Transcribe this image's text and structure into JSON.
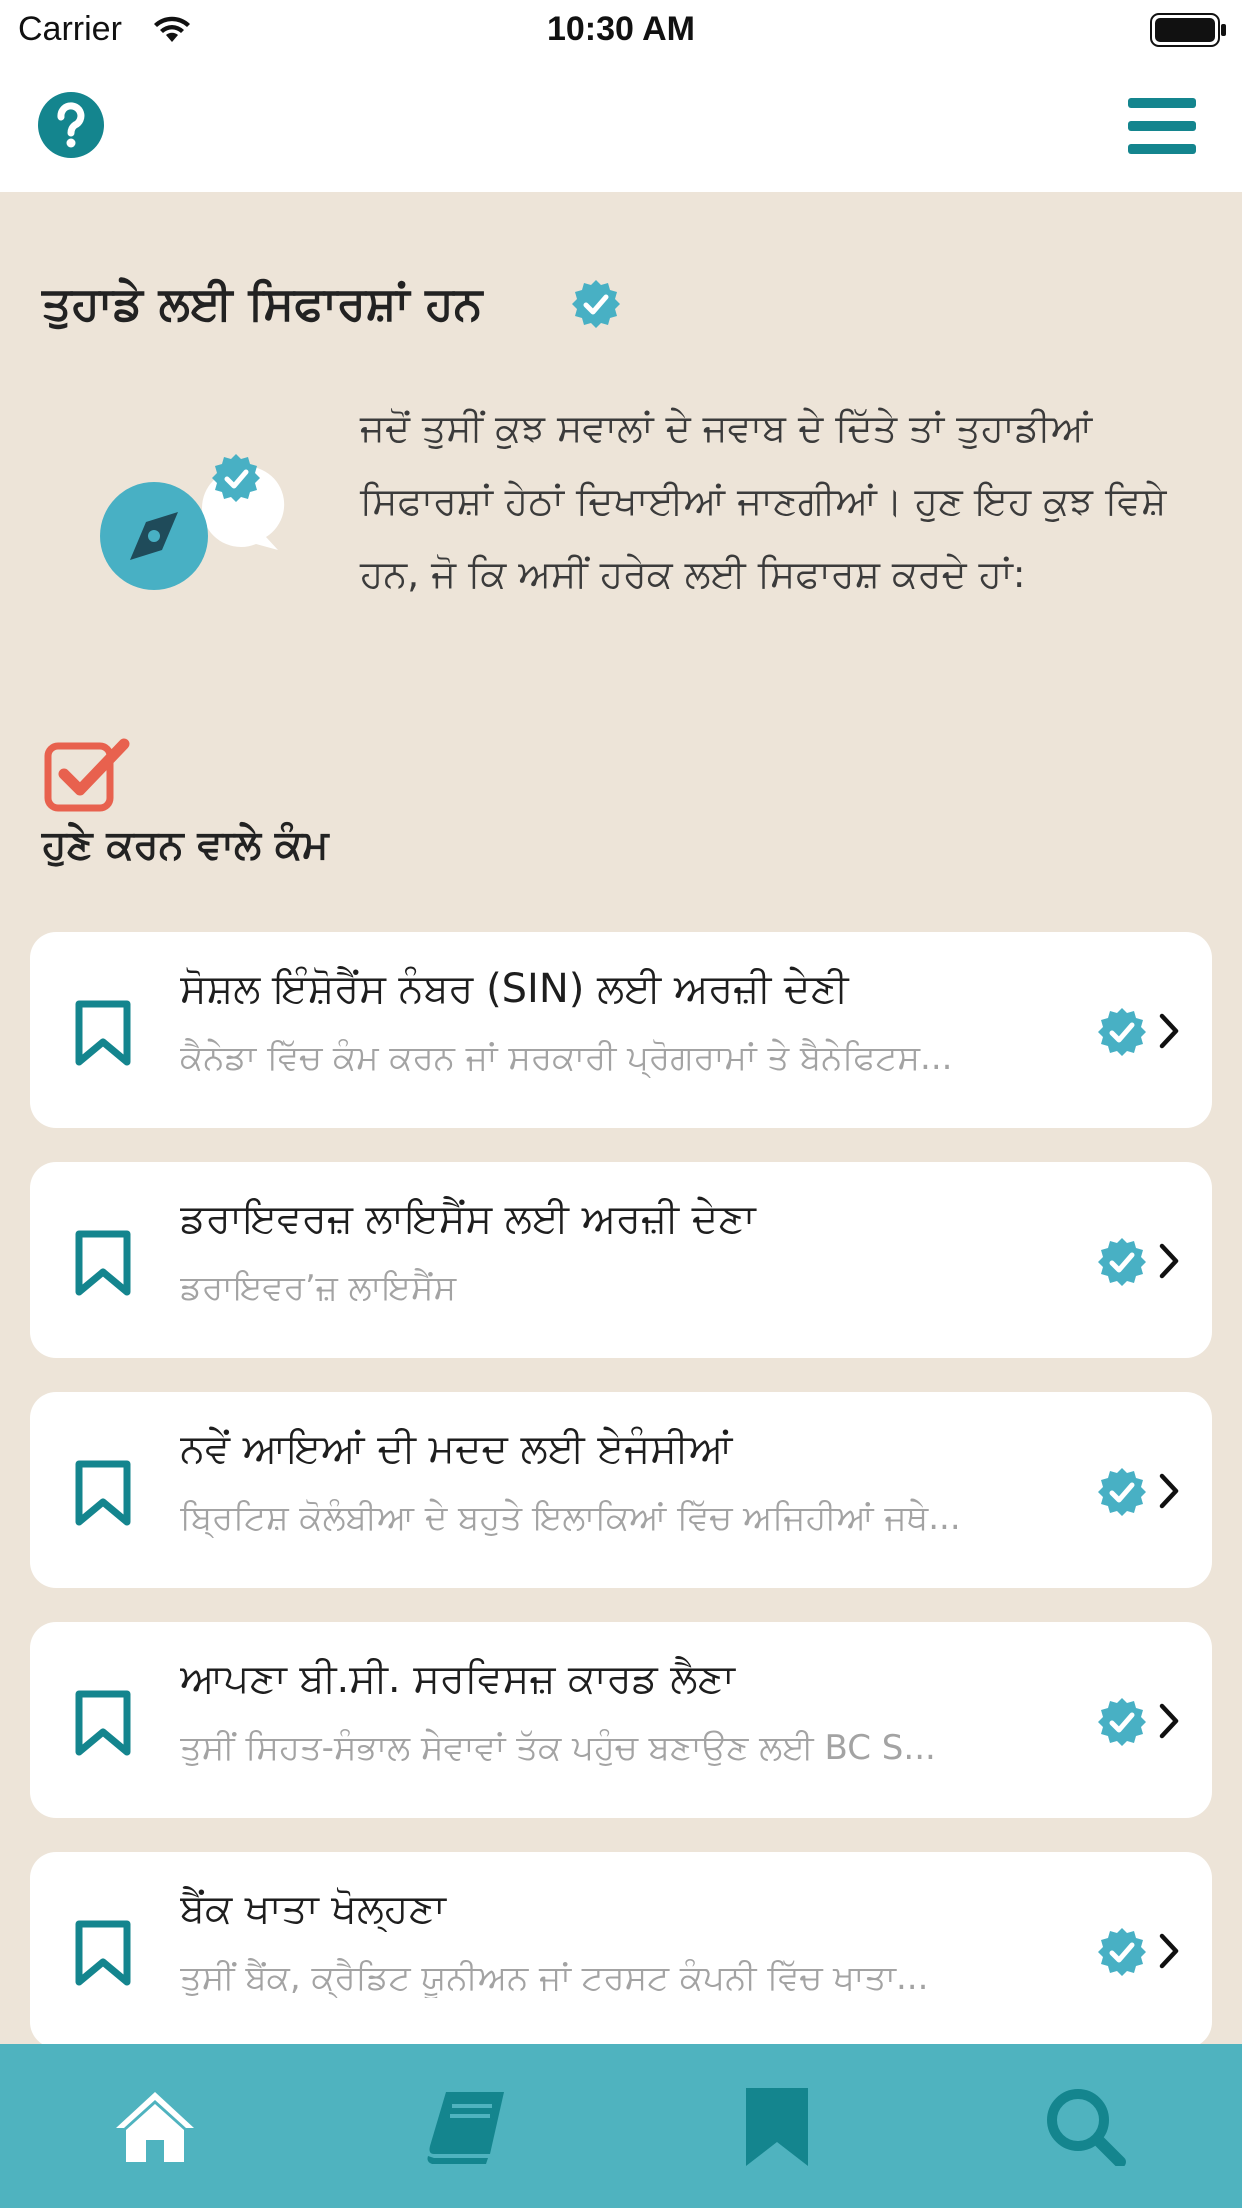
{
  "status_bar": {
    "carrier": "Carrier",
    "time": "10:30 AM"
  },
  "colors": {
    "teal": "#14858e",
    "light_teal": "#4fb3bf",
    "beige": "#ede4d8",
    "todo_red": "#e8614e",
    "badge": "#48b0c4"
  },
  "navbar": {
    "help_icon": "question-circle-icon",
    "menu_icon": "hamburger-menu-icon"
  },
  "recommendations": {
    "title": "ਤੁਹਾਡੇ ਲਈ ਸਿਫਾਰਸ਼ਾਂ ਹਨ",
    "intro": "ਜਦੋਂ ਤੁਸੀਂ ਕੁਝ ਸਵਾਲਾਂ ਦੇ ਜਵਾਬ ਦੇ ਦਿੱਤੇ ਤਾਂ ਤੁਹਾਡੀਆਂ ਸਿਫਾਰਸ਼ਾਂ ਹੇਠਾਂ ਦਿਖਾਈਆਂ ਜਾਣਗੀਆਂ। ਹੁਣ ਇਹ ਕੁਝ ਵਿਸ਼ੇ ਹਨ, ਜੋ ਕਿ ਅਸੀਂ ਹਰੇਕ ਲਈ ਸਿਫਾਰਸ਼ ਕਰਦੇ ਹਾਂ:"
  },
  "todo": {
    "title": "ਹੁਣੇ ਕਰਨ ਵਾਲੇ ਕੰਮ",
    "items": [
      {
        "title": "ਸੋਸ਼ਲ ਇੰਸ਼ੋਰੈਂਸ ਨੰਬਰ (SIN) ਲਈ ਅਰਜ਼ੀ ਦੇਣੀ",
        "subtitle": "ਕੈਨੇਡਾ ਵਿੱਚ ਕੰਮ ਕਰਨ ਜਾਂ ਸਰਕਾਰੀ ਪ੍ਰੋਗਰਾਮਾਂ ਤੇ ਬੈਨੇਫਿਟਸ..."
      },
      {
        "title": "ਡਰਾਇਵਰਜ਼ ਲਾਇਸੈਂਸ ਲਈ ਅਰਜ਼ੀ ਦੇਣਾ",
        "subtitle": "ਡਰਾਇਵਰ’ਜ਼ ਲਾਇਸੈਂਸ"
      },
      {
        "title": "ਨਵੇਂ ਆਇਆਂ ਦੀ ਮਦਦ ਲਈ ਏਜੰਸੀਆਂ",
        "subtitle": "ਬ੍ਰਿਟਿਸ਼ ਕੋਲੰਬੀਆ ਦੇ ਬਹੁਤੇ ਇਲਾਕਿਆਂ ਵਿੱਚ ਅਜਿਹੀਆਂ ਜਥੇ..."
      },
      {
        "title": "ਆਪਣਾ ਬੀ.ਸੀ. ਸਰਵਿਸਜ਼ ਕਾਰਡ ਲੈਣਾ",
        "subtitle": "ਤੁਸੀਂ ਸਿਹਤ-ਸੰਭਾਲ ਸੇਵਾਵਾਂ ਤੱਕ ਪਹੁੰਚ ਬਣਾਉਣ ਲਈ BC S..."
      },
      {
        "title": "ਬੈਂਕ ਖਾਤਾ ਖੋਲ੍ਹਣਾ",
        "subtitle": "ਤੁਸੀਂ ਬੈਂਕ, ਕ੍ਰੈਡਿਟ ਯੂਨੀਅਨ ਜਾਂ ਟਰਸਟ ਕੰਪਨੀ ਵਿੱਚ ਖਾਤਾ..."
      }
    ]
  },
  "tabbar": {
    "tabs": [
      {
        "icon": "home-icon"
      },
      {
        "icon": "book-icon"
      },
      {
        "icon": "bookmark-icon"
      },
      {
        "icon": "search-icon"
      }
    ]
  }
}
